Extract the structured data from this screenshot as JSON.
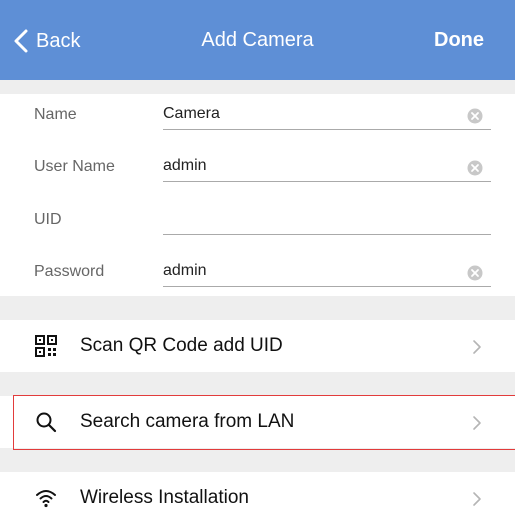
{
  "navbar": {
    "back_label": "Back",
    "title": "Add Camera",
    "done_label": "Done",
    "bg_color": "#5e8fd6"
  },
  "form": {
    "name": {
      "label": "Name",
      "value": "Camera"
    },
    "user_name": {
      "label": "User Name",
      "value": "admin"
    },
    "uid": {
      "label": "UID",
      "value": ""
    },
    "password": {
      "label": "Password",
      "value": "admin"
    }
  },
  "actions": {
    "scan_qr": {
      "label": "Scan QR Code add UID",
      "icon": "qr-code-icon"
    },
    "search_lan": {
      "label": "Search camera from LAN",
      "icon": "search-icon"
    },
    "wireless": {
      "label": "Wireless Installation",
      "icon": "wifi-icon"
    }
  },
  "highlight_color": "#e23b3b"
}
